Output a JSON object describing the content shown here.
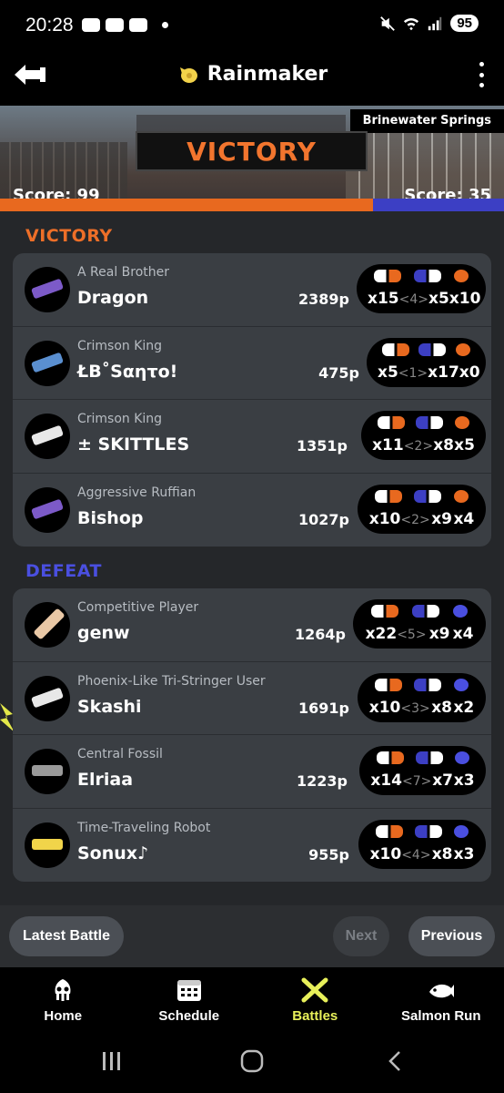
{
  "status_bar": {
    "time": "20:28",
    "battery": "95"
  },
  "header": {
    "title": "Rainmaker",
    "mode_icon": "rainmaker-icon",
    "back_icon": "back-arrow-icon",
    "menu_icon": "more-vert-icon"
  },
  "banner": {
    "stage": "Brinewater Springs",
    "result": "VICTORY",
    "score_left": "Score: 99",
    "score_right": "Score: 35",
    "colors": {
      "alpha": "#e8691f",
      "bravo": "#3c3fc4"
    }
  },
  "teams": {
    "win": {
      "label": "VICTORY",
      "players": [
        {
          "title": "A Real Brother",
          "name": "Dragon",
          "points": "2389p",
          "kills": "x15",
          "assists": "<4>",
          "deaths": "x5",
          "specials": "x10"
        },
        {
          "title": "Crimson King",
          "name": "ŁB˚Sαητο!",
          "points": "475p",
          "kills": "x5",
          "assists": "<1>",
          "deaths": "x17",
          "specials": "x0"
        },
        {
          "title": "Crimson King",
          "name": "± SKITTLES",
          "points": "1351p",
          "kills": "x11",
          "assists": "<2>",
          "deaths": "x8",
          "specials": "x5"
        },
        {
          "title": "Aggressive Ruffian",
          "name": "Bishop",
          "points": "1027p",
          "kills": "x10",
          "assists": "<2>",
          "deaths": "x9",
          "specials": "x4"
        }
      ]
    },
    "lose": {
      "label": "DEFEAT",
      "players": [
        {
          "title": "Competitive Player",
          "name": "genw",
          "points": "1264p",
          "kills": "x22",
          "assists": "<5>",
          "deaths": "x9",
          "specials": "x4"
        },
        {
          "title": "Phoenix-Like Tri-Stringer User",
          "name": "Skashi",
          "points": "1691p",
          "kills": "x10",
          "assists": "<3>",
          "deaths": "x8",
          "specials": "x2"
        },
        {
          "title": "Central Fossil",
          "name": "Elriaa",
          "points": "1223p",
          "kills": "x14",
          "assists": "<7>",
          "deaths": "x7",
          "specials": "x3"
        },
        {
          "title": "Time-Traveling Robot",
          "name": "Sonux♪",
          "points": "955p",
          "kills": "x10",
          "assists": "<4>",
          "deaths": "x8",
          "specials": "x3"
        }
      ]
    }
  },
  "buttons": {
    "latest": "Latest Battle",
    "next": "Next",
    "previous": "Previous"
  },
  "nav": {
    "home": "Home",
    "schedule": "Schedule",
    "battles": "Battles",
    "salmon": "Salmon Run"
  }
}
